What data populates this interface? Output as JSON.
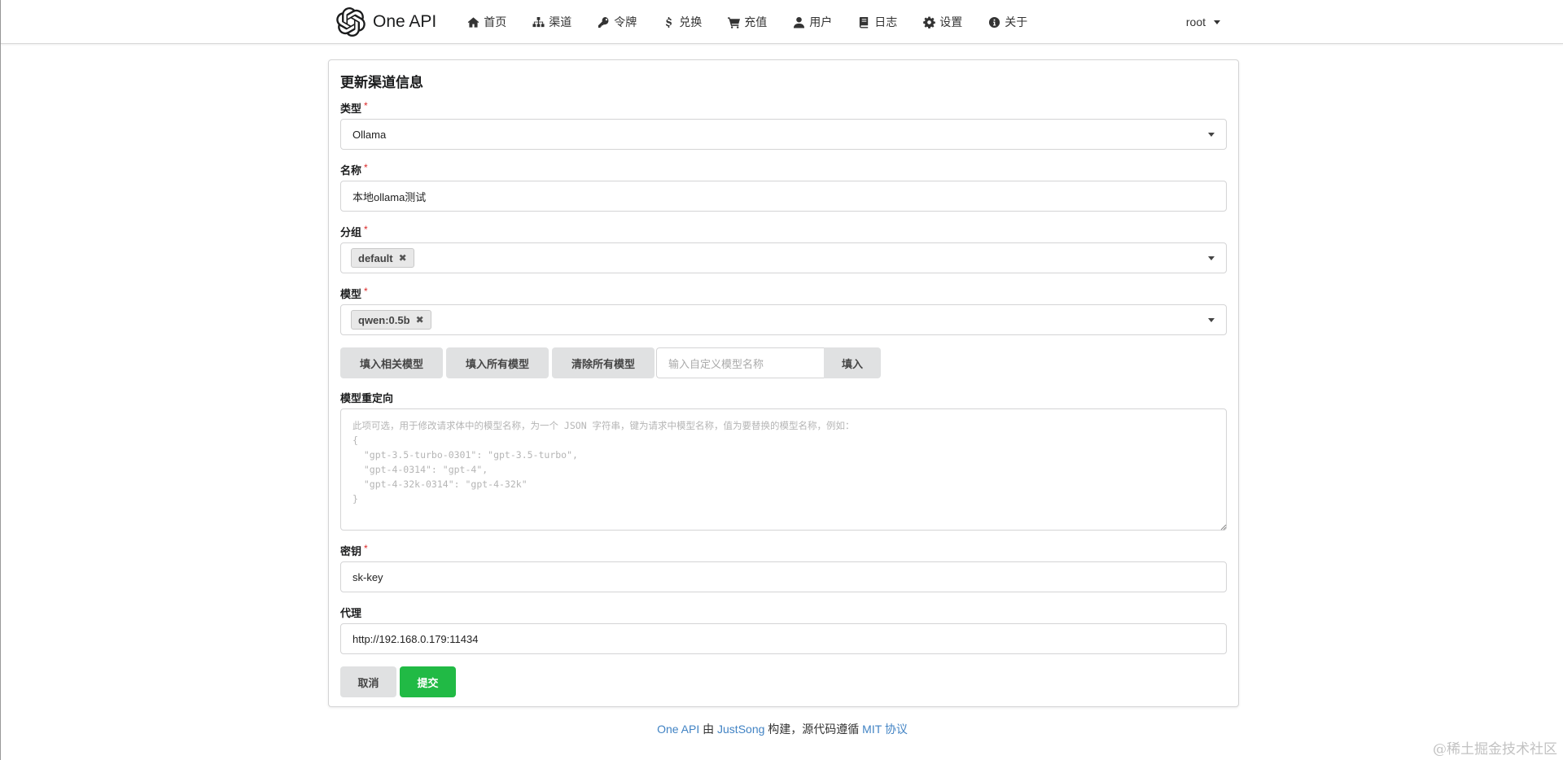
{
  "brand": {
    "name": "One API",
    "logo_icon": "openai-logo-icon"
  },
  "nav": [
    {
      "label": "首页",
      "icon": "home-icon"
    },
    {
      "label": "渠道",
      "icon": "sitemap-icon"
    },
    {
      "label": "令牌",
      "icon": "key-icon"
    },
    {
      "label": "兑换",
      "icon": "dollar-icon"
    },
    {
      "label": "充值",
      "icon": "cart-icon"
    },
    {
      "label": "用户",
      "icon": "user-icon"
    },
    {
      "label": "日志",
      "icon": "book-icon"
    },
    {
      "label": "设置",
      "icon": "gear-icon"
    },
    {
      "label": "关于",
      "icon": "info-icon"
    }
  ],
  "user_menu": {
    "label": "root"
  },
  "form": {
    "title": "更新渠道信息",
    "type": {
      "label": "类型",
      "required": "*",
      "value": "Ollama"
    },
    "name": {
      "label": "名称",
      "required": "*",
      "value": "本地ollama测试"
    },
    "group": {
      "label": "分组",
      "required": "*",
      "chips": [
        "default"
      ]
    },
    "models": {
      "label": "模型",
      "required": "*",
      "chips": [
        "qwen:0.5b"
      ]
    },
    "model_buttons": {
      "fill_related": "填入相关模型",
      "fill_all": "填入所有模型",
      "clear_all": "清除所有模型",
      "custom_placeholder": "输入自定义模型名称",
      "fill": "填入"
    },
    "mapping": {
      "label": "模型重定向",
      "placeholder": "此项可选，用于修改请求体中的模型名称，为一个 JSON 字符串，键为请求中模型名称，值为要替换的模型名称，例如：\n{\n  \"gpt-3.5-turbo-0301\": \"gpt-3.5-turbo\",\n  \"gpt-4-0314\": \"gpt-4\",\n  \"gpt-4-32k-0314\": \"gpt-4-32k\"\n}"
    },
    "key": {
      "label": "密钥",
      "required": "*",
      "value": "sk-key"
    },
    "proxy": {
      "label": "代理",
      "value": "http://192.168.0.179:11434"
    },
    "cancel": "取消",
    "submit": "提交"
  },
  "footer": {
    "app_link": "One API",
    "by": " 由 ",
    "author_link": "JustSong",
    "built": " 构建，源代码遵循 ",
    "license_link": "MIT 协议"
  },
  "watermark": "@稀土掘金技术社区",
  "colors": {
    "submit_green": "#21ba45",
    "link_blue": "#4183c4",
    "required_red": "#db2828"
  }
}
